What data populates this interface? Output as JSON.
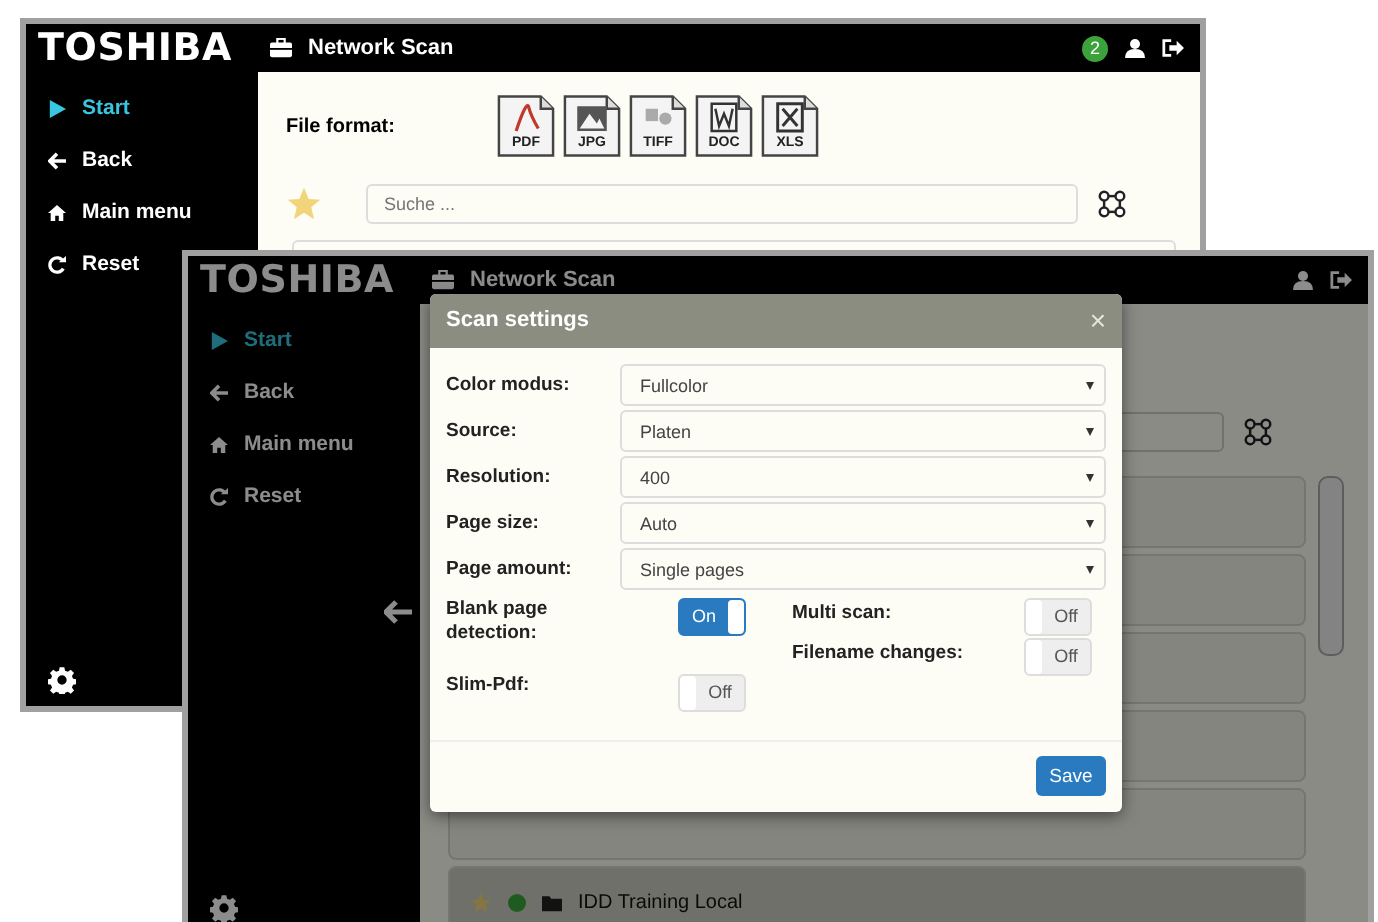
{
  "front_window": {
    "logo": "TOSHIBA",
    "title": "Network Scan",
    "badge": "2",
    "nav": [
      {
        "label": "Start",
        "selected": true
      },
      {
        "label": "Back",
        "selected": false
      },
      {
        "label": "Main menu",
        "selected": false
      },
      {
        "label": "Reset",
        "selected": false
      }
    ],
    "file_format_label": "File format:",
    "formats": [
      {
        "label": "PDF",
        "kind": "pdf"
      },
      {
        "label": "JPG",
        "kind": "image"
      },
      {
        "label": "TIFF",
        "kind": "tiff"
      },
      {
        "label": "DOC",
        "kind": "doc"
      },
      {
        "label": "XLS",
        "kind": "xls"
      }
    ],
    "search": {
      "placeholder": "Suche ..."
    }
  },
  "back_window": {
    "logo": "TOSHIBA",
    "title": "Network Scan",
    "nav": [
      {
        "label": "Start",
        "selected": true
      },
      {
        "label": "Back",
        "selected": false
      },
      {
        "label": "Main menu",
        "selected": false
      },
      {
        "label": "Reset",
        "selected": false
      }
    ],
    "list_rows": [
      {
        "selected": false
      },
      {
        "selected": false
      },
      {
        "selected": false
      },
      {
        "selected": false
      },
      {
        "selected": false
      },
      {
        "label": "IDD Training Local",
        "selected": true
      }
    ]
  },
  "modal": {
    "title": "Scan settings",
    "close": "×",
    "selects": [
      {
        "label": "Color modus:",
        "value": "Fullcolor"
      },
      {
        "label": "Source:",
        "value": "Platen"
      },
      {
        "label": "Resolution:",
        "value": "400"
      },
      {
        "label": "Page size:",
        "value": "Auto"
      },
      {
        "label": "Page amount:",
        "value": "Single pages"
      }
    ],
    "left_toggles": [
      {
        "label": "Blank page detection:",
        "on": true,
        "text": "On"
      },
      {
        "label": "Slim-Pdf:",
        "on": false,
        "text": "Off"
      }
    ],
    "right_toggles": [
      {
        "label": "Multi scan:",
        "on": false,
        "text": "Off"
      },
      {
        "label": "Filename changes:",
        "on": false,
        "text": "Off"
      }
    ],
    "save": "Save"
  }
}
